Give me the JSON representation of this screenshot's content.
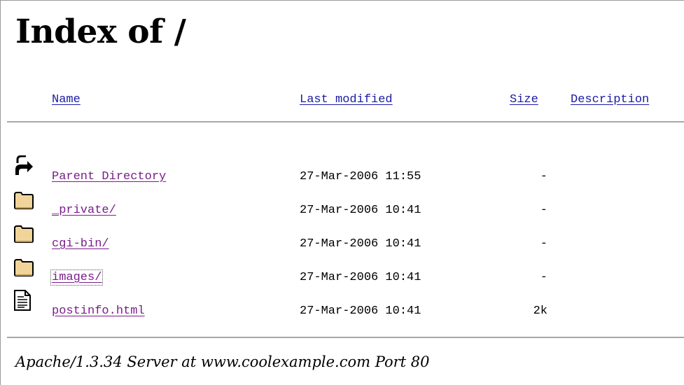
{
  "page": {
    "title": "Index of /"
  },
  "columns": {
    "name": "Name",
    "last_modified": "Last modified",
    "size": "Size",
    "description": "Description"
  },
  "entries": [
    {
      "icon": "back-icon",
      "name": "Parent Directory",
      "modified": "27-Mar-2006 11:55",
      "size": "-"
    },
    {
      "icon": "folder-icon",
      "name": "_private/",
      "modified": "27-Mar-2006 10:41",
      "size": "-"
    },
    {
      "icon": "folder-icon",
      "name": "cgi-bin/",
      "modified": "27-Mar-2006 10:41",
      "size": "-"
    },
    {
      "icon": "folder-icon",
      "name": "images/",
      "modified": "27-Mar-2006 10:41",
      "size": "-"
    },
    {
      "icon": "text-file-icon",
      "name": "postinfo.html",
      "modified": "27-Mar-2006 10:41",
      "size": "2k"
    }
  ],
  "footer": {
    "text": "Apache/1.3.34 Server at www.coolexample.com Port 80"
  },
  "colors": {
    "link": "#1a1aa6",
    "visited_link": "#7a1d8a",
    "rule": "#a8a8a8"
  }
}
